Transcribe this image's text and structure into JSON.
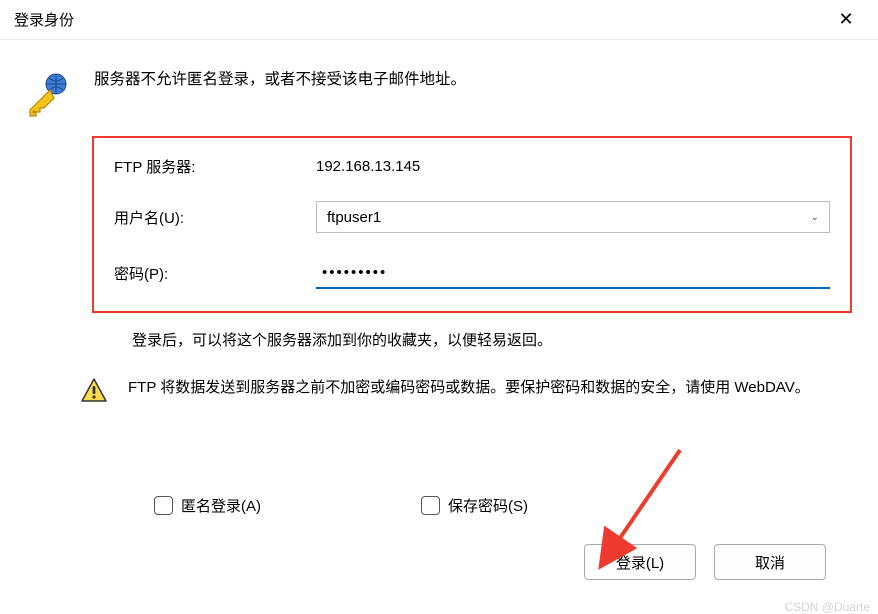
{
  "titlebar": {
    "title": "登录身份"
  },
  "main_message": "服务器不允许匿名登录，或者不接受该电子邮件地址。",
  "form": {
    "server_label": "FTP 服务器:",
    "server_value": "192.168.13.145",
    "username_label": "用户名(U):",
    "username_value": "ftpuser1",
    "password_label": "密码(P):",
    "password_value": "•••••••••"
  },
  "hint": "登录后，可以将这个服务器添加到你的收藏夹，以便轻易返回。",
  "warning": "FTP 将数据发送到服务器之前不加密或编码密码或数据。要保护密码和数据的安全，请使用 WebDAV。",
  "checkboxes": {
    "anonymous_label": "匿名登录(A)",
    "save_password_label": "保存密码(S)"
  },
  "buttons": {
    "login_label": "登录(L)",
    "cancel_label": "取消"
  },
  "watermark": "CSDN @Duarte"
}
